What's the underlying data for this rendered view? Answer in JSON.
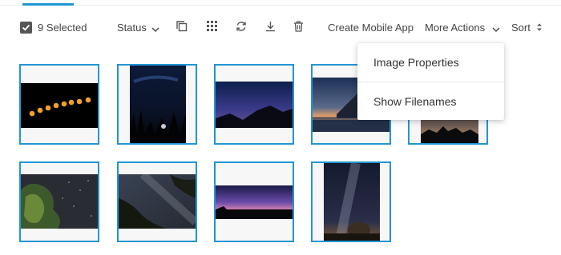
{
  "toolbar": {
    "selected_label": "9 Selected",
    "status_label": "Status",
    "duplicate_icon": "copy-icon",
    "grid_icon": "grid-icon",
    "refresh_icon": "refresh-icon",
    "download_icon": "download-icon",
    "delete_icon": "trash-icon",
    "create_mobile_app_label": "Create Mobile App",
    "more_actions_label": "More Actions",
    "sort_label": "Sort"
  },
  "more_actions_menu": {
    "items": [
      "Image Properties",
      "Show Filenames"
    ]
  },
  "gallery": {
    "selected_count": 9,
    "images": [
      {
        "subject": "eclipse sequence"
      },
      {
        "subject": "night forest lightning"
      },
      {
        "subject": "mountain twilight"
      },
      {
        "subject": "mountain lake dusk"
      },
      {
        "subject": "astronomers silhouette"
      },
      {
        "subject": "tree star field"
      },
      {
        "subject": "trees milky way"
      },
      {
        "subject": "aurora horizon"
      },
      {
        "subject": "milky way hay bale"
      }
    ]
  },
  "colors": {
    "accent": "#2196d3",
    "checkbox": "#555555"
  }
}
